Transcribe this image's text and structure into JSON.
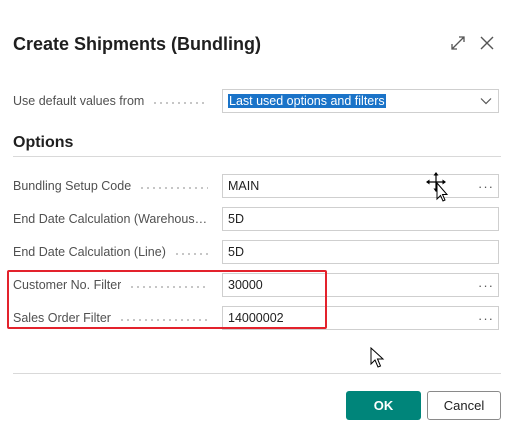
{
  "dialog": {
    "title": "Create Shipments (Bundling)"
  },
  "defaults": {
    "label": "Use default values from",
    "value": "Last used options and filters"
  },
  "options": {
    "heading": "Options",
    "fields": [
      {
        "label": "Bundling Setup Code",
        "value": "MAIN"
      },
      {
        "label": "End Date Calculation (Warehouse...",
        "value": "5D"
      },
      {
        "label": "End Date Calculation (Line)",
        "value": "5D"
      },
      {
        "label": "Customer No. Filter",
        "value": "30000"
      },
      {
        "label": "Sales Order Filter",
        "value": "14000002"
      }
    ]
  },
  "actions": {
    "ok_label": "OK",
    "cancel_label": "Cancel"
  },
  "assist_glyph": "···",
  "colors": {
    "accent": "#00857a",
    "highlight": "#1a73c8",
    "annotation": "#e3222c"
  }
}
